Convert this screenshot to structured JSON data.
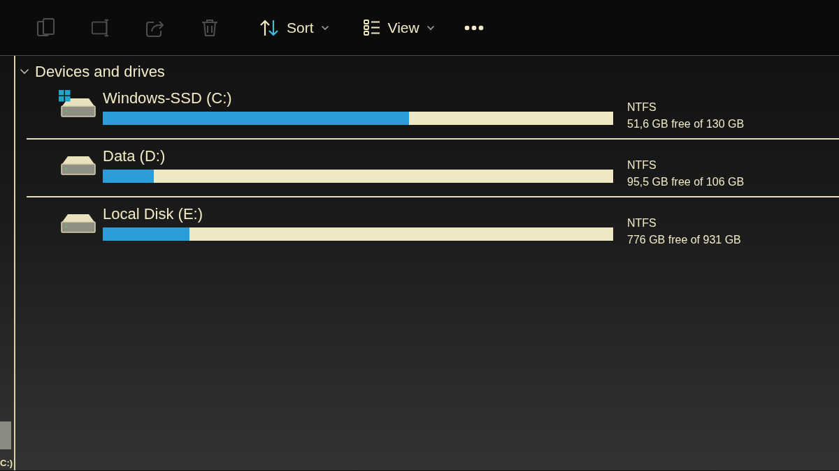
{
  "toolbar": [
    {
      "kind": "copy",
      "disabled": true
    },
    {
      "kind": "rename",
      "disabled": true
    },
    {
      "kind": "share",
      "disabled": true
    },
    {
      "kind": "delete",
      "disabled": true
    },
    {
      "kind": "sort",
      "label": "Sort",
      "disabled": false
    },
    {
      "kind": "view",
      "label": "View",
      "disabled": false
    },
    {
      "kind": "more",
      "disabled": false
    }
  ],
  "nav_pane": {
    "items": [
      {
        "label": "C:)",
        "selected": true
      }
    ]
  },
  "section": {
    "title": "Devices and drives",
    "expanded": true
  },
  "drives": [
    {
      "kind": "system",
      "name": "Windows-SSD (C:)",
      "filesystem": "NTFS",
      "free": "51,6 GB free of 130 GB",
      "level": 0.6
    },
    {
      "kind": "disk",
      "name": "Data (D:)",
      "filesystem": "NTFS",
      "free": "95,5 GB free of 106 GB",
      "level": 0.1
    },
    {
      "kind": "disk",
      "name": "Local Disk (E:)",
      "filesystem": "NTFS",
      "free": "776 GB free of 931 GB",
      "level": 0.17
    }
  ]
}
